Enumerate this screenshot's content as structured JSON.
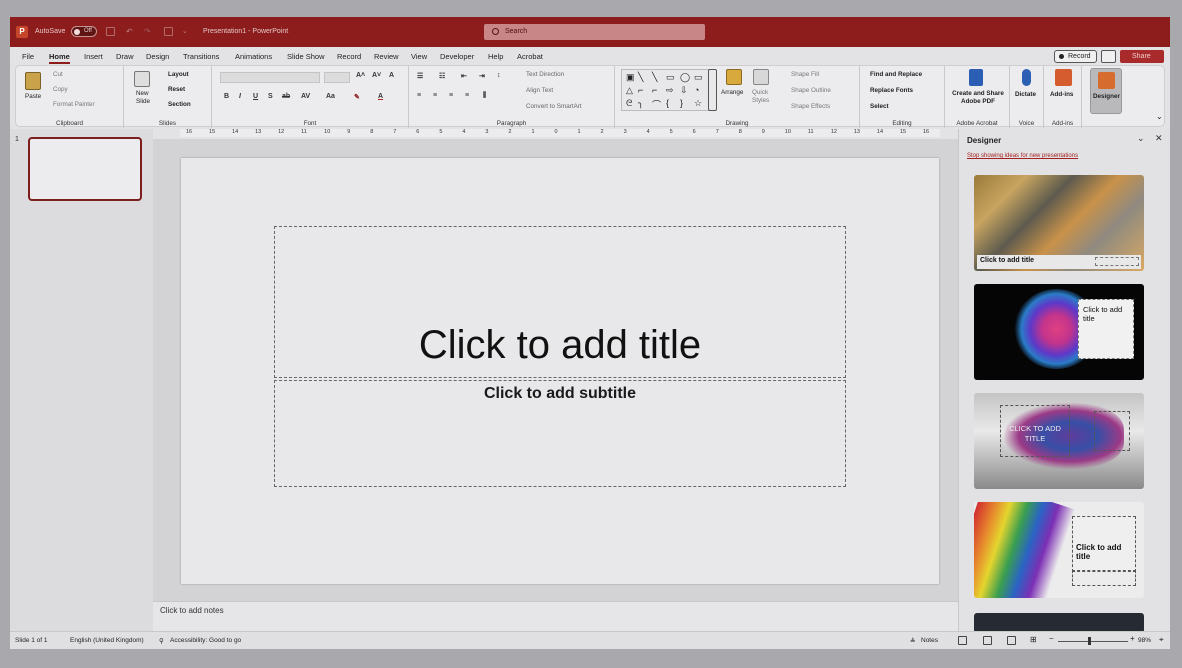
{
  "titlebar": {
    "autosave_label": "AutoSave",
    "autosave_state": "Off",
    "document_name": "Presentation1 - PowerPoint",
    "search_placeholder": "Search"
  },
  "menu": {
    "tabs": [
      "File",
      "Home",
      "Insert",
      "Draw",
      "Design",
      "Transitions",
      "Animations",
      "Slide Show",
      "Record",
      "Review",
      "View",
      "Developer",
      "Help",
      "Acrobat"
    ],
    "active_tab": "Home",
    "record_label": "Record",
    "share_label": "Share"
  },
  "ribbon": {
    "clipboard": {
      "paste": "Paste",
      "cut": "Cut",
      "copy": "Copy",
      "format_painter": "Format Painter",
      "label": "Clipboard"
    },
    "slides": {
      "new_slide": "New Slide",
      "layout": "Layout",
      "reset": "Reset",
      "section": "Section",
      "label": "Slides"
    },
    "font": {
      "label": "Font"
    },
    "paragraph": {
      "text_direction": "Text Direction",
      "align_text": "Align Text",
      "convert_smartart": "Convert to SmartArt",
      "label": "Paragraph"
    },
    "drawing": {
      "arrange": "Arrange",
      "quick_styles": "Quick Styles",
      "shape_fill": "Shape Fill",
      "shape_outline": "Shape Outline",
      "shape_effects": "Shape Effects",
      "label": "Drawing"
    },
    "editing": {
      "find_replace": "Find and Replace",
      "replace_fonts": "Replace Fonts",
      "select": "Select",
      "label": "Editing"
    },
    "acrobat": {
      "create_share": "Create and Share Adobe PDF",
      "label": "Adobe Acrobat"
    },
    "voice": {
      "dictate": "Dictate",
      "label": "Voice"
    },
    "addins": {
      "addins": "Add-ins",
      "label": "Add-ins"
    },
    "designer": {
      "label": "Designer"
    }
  },
  "thumbnails": {
    "slide_number": "1"
  },
  "ruler": {
    "h_ticks": [
      "16",
      "15",
      "14",
      "13",
      "12",
      "11",
      "10",
      "9",
      "8",
      "7",
      "6",
      "5",
      "4",
      "3",
      "2",
      "1",
      "0",
      "1",
      "2",
      "3",
      "4",
      "5",
      "6",
      "7",
      "8",
      "9",
      "10",
      "11",
      "12",
      "13",
      "14",
      "15",
      "16"
    ]
  },
  "slide": {
    "title_placeholder": "Click to add title",
    "subtitle_placeholder": "Click to add subtitle"
  },
  "notes": {
    "placeholder": "Click to add notes"
  },
  "designer_pane": {
    "title": "Designer",
    "stop_link": "Stop showing ideas for new presentations",
    "ideas": [
      {
        "title": "Click to add title"
      },
      {
        "title": "Click to add title"
      },
      {
        "title": "CLICK TO ADD TITLE"
      },
      {
        "title": "Click to add title"
      }
    ]
  },
  "status": {
    "slide_info": "Slide 1 of 1",
    "language": "English (United Kingdom)",
    "accessibility": "Accessibility: Good to go",
    "notes_label": "Notes",
    "zoom": "98%"
  }
}
